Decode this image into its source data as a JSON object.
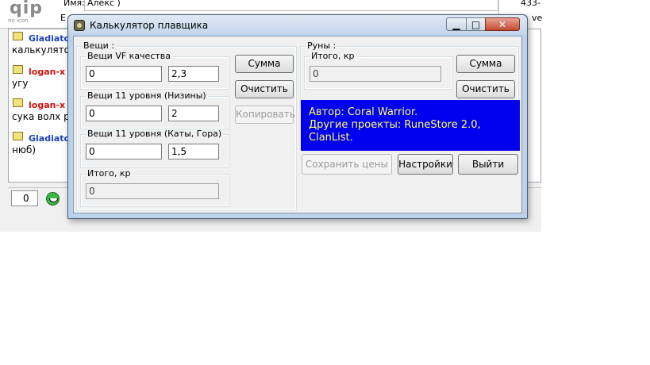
{
  "background": {
    "logo_text": "qip",
    "logo_sub": "no icon",
    "name_label": "Имя:",
    "name_value": "Алекс )",
    "second_label": "E",
    "right_top": "433-",
    "right_second": "ve",
    "messages": [
      {
        "nick": "Gladiator",
        "text": "калькулятор",
        "nick_color": "#1a3fbf"
      },
      {
        "nick": "logan-x (",
        "text": "угу",
        "nick_color": "#d01010"
      },
      {
        "nick": "logan-x (",
        "text": "сука волх ре",
        "nick_color": "#d01010"
      },
      {
        "nick": "Gladiator",
        "text": "нюб)",
        "nick_color": "#1a3fbf"
      }
    ],
    "counter_value": "0"
  },
  "window": {
    "title": "Калькулятор плавщика",
    "close_glyph": "✕",
    "min_glyph": "▁",
    "max_glyph": "□",
    "items": {
      "label": "Вещи :",
      "vf": {
        "label": "Вещи VF качества",
        "count": "0",
        "factor": "2,3"
      },
      "lvl11_low": {
        "label": "Вещи 11 уровня (Низины)",
        "count": "0",
        "factor": "2"
      },
      "lvl11_cave": {
        "label": "Вещи 11 уровня (Каты, Гора)",
        "count": "0",
        "factor": "1,5"
      },
      "total": {
        "label": "Итого, кр",
        "value": "0"
      },
      "btn_sum": "Сумма",
      "btn_clear": "Очистить",
      "btn_copy": "Копировать"
    },
    "runes": {
      "label": "Руны :",
      "total": {
        "label": "Итого, кр",
        "value": "0"
      },
      "btn_sum": "Сумма",
      "btn_clear": "Очистить"
    },
    "info": {
      "line1": "Автор: Coral Warrior.",
      "line2": "Другие проекты: RuneStore 2.0,",
      "line3": "ClanList.",
      "bg_color": "#0000ee",
      "text_color": "#ffff66"
    },
    "btn_save_prices": "Сохранить цены",
    "btn_settings": "Настройки",
    "btn_exit": "Выйти"
  }
}
